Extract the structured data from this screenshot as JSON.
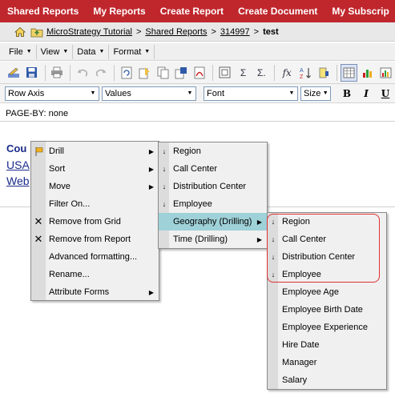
{
  "topnav": {
    "items": [
      "Shared Reports",
      "My Reports",
      "Create Report",
      "Create Document",
      "My Subscrip"
    ]
  },
  "breadcrumb": {
    "home_icon": "home-icon",
    "folder_icon": "folder-up-icon",
    "items": [
      "MicroStrategy Tutorial",
      "Shared Reports",
      "314997"
    ],
    "separator": ">",
    "current": "test"
  },
  "menubar": {
    "items": [
      "File",
      "View",
      "Data",
      "Format"
    ]
  },
  "format_toolbar": {
    "axis_value": "Row Axis",
    "values_value": "Values",
    "font_value": "Font",
    "size_value": "Size",
    "bold": "B",
    "italic": "I",
    "underline": "U"
  },
  "page_by": "PAGE-BY:  none",
  "grid": {
    "header": "Cou",
    "rows": [
      "USA",
      "Web"
    ]
  },
  "context_menu": {
    "items": [
      {
        "label": "Drill",
        "icon": "drill-icon",
        "submenu": true
      },
      {
        "label": "Sort",
        "submenu": true
      },
      {
        "label": "Move",
        "submenu": true
      },
      {
        "label": "Filter On..."
      },
      {
        "label": "Remove from Grid",
        "icon": "remove-icon"
      },
      {
        "label": "Remove from Report",
        "icon": "remove-icon"
      },
      {
        "label": "Advanced formatting..."
      },
      {
        "label": "Rename..."
      },
      {
        "label": "Attribute Forms",
        "submenu": true
      }
    ]
  },
  "drill_menu": {
    "items": [
      {
        "label": "Region",
        "icon": "drill-down-arrow-icon"
      },
      {
        "label": "Call Center",
        "icon": "drill-down-arrow-icon"
      },
      {
        "label": "Distribution Center",
        "icon": "drill-down-arrow-icon"
      },
      {
        "label": "Employee",
        "icon": "drill-down-arrow-icon"
      },
      {
        "label": "Geography (Drilling)",
        "submenu": true,
        "highlighted": true
      },
      {
        "label": "Time (Drilling)",
        "submenu": true
      }
    ]
  },
  "geography_menu": {
    "items": [
      {
        "label": "Region",
        "icon": "drill-down-arrow-icon"
      },
      {
        "label": "Call Center",
        "icon": "drill-down-arrow-icon"
      },
      {
        "label": "Distribution Center",
        "icon": "drill-down-arrow-icon"
      },
      {
        "label": "Employee",
        "icon": "drill-down-arrow-icon"
      },
      {
        "label": "Employee Age"
      },
      {
        "label": "Employee Birth Date"
      },
      {
        "label": "Employee Experience"
      },
      {
        "label": "Hire Date"
      },
      {
        "label": "Manager"
      },
      {
        "label": "Salary"
      }
    ]
  },
  "colors": {
    "topnav_bg": "#c0272d",
    "highlight": "#9fd1d8",
    "callout_border": "#e03030",
    "grid_text": "#1a2a8a"
  }
}
